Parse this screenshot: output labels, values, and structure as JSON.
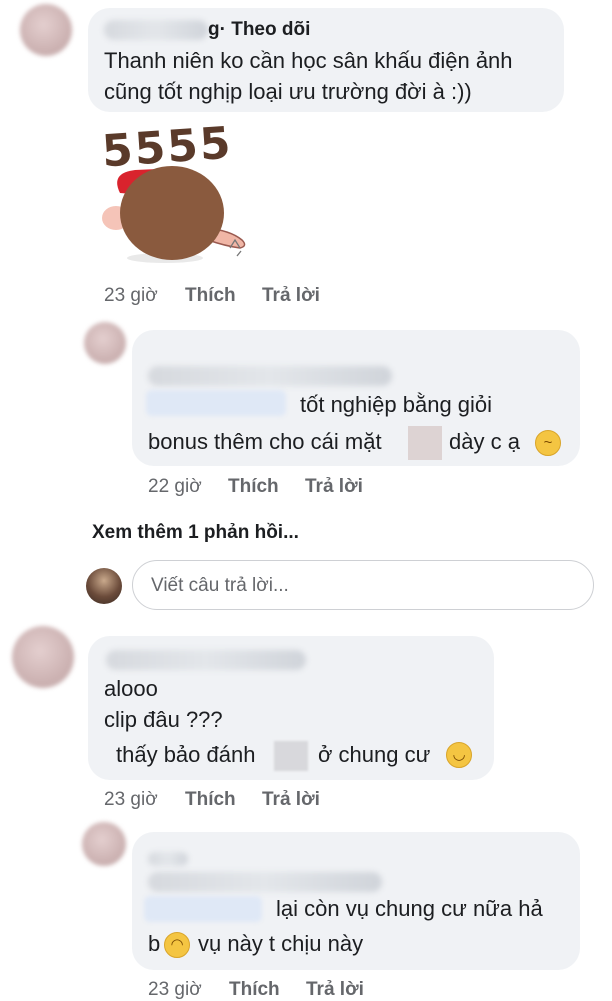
{
  "comment1": {
    "author_partial": "g",
    "follow_label": "· Theo dõi",
    "lines": [
      "Thanh niên ko cần học sân khấu điện ảnh",
      "cũng tốt nghịp loại ưu trường đời à :))"
    ],
    "sticker_text": "5555",
    "time": "23 giờ",
    "like": "Thích",
    "reply": "Trả lời"
  },
  "reply1": {
    "lines": [
      "tốt nghiệp bằng giỏi",
      "bonus thêm cho cái mặt",
      "dày c ạ"
    ],
    "time": "22 giờ",
    "like": "Thích",
    "reply": "Trả lời"
  },
  "see_more": "Xem thêm 1 phản hồi...",
  "reply_box": {
    "placeholder": "Viết câu trả lời..."
  },
  "comment2": {
    "lines": [
      "alooo",
      "clip đâu ???",
      "thấy bảo đánh",
      "ở chung cư"
    ],
    "time": "23 giờ",
    "like": "Thích",
    "reply": "Trả lời"
  },
  "reply2": {
    "lines": [
      "lại còn vụ chung cư nữa hả",
      "b",
      "vụ này t chịu này"
    ],
    "time": "23 giờ",
    "like": "Thích",
    "reply": "Trả lời"
  },
  "colors": {
    "bubble": "#f0f2f5",
    "meta": "#65676b",
    "text": "#1c1e21"
  }
}
